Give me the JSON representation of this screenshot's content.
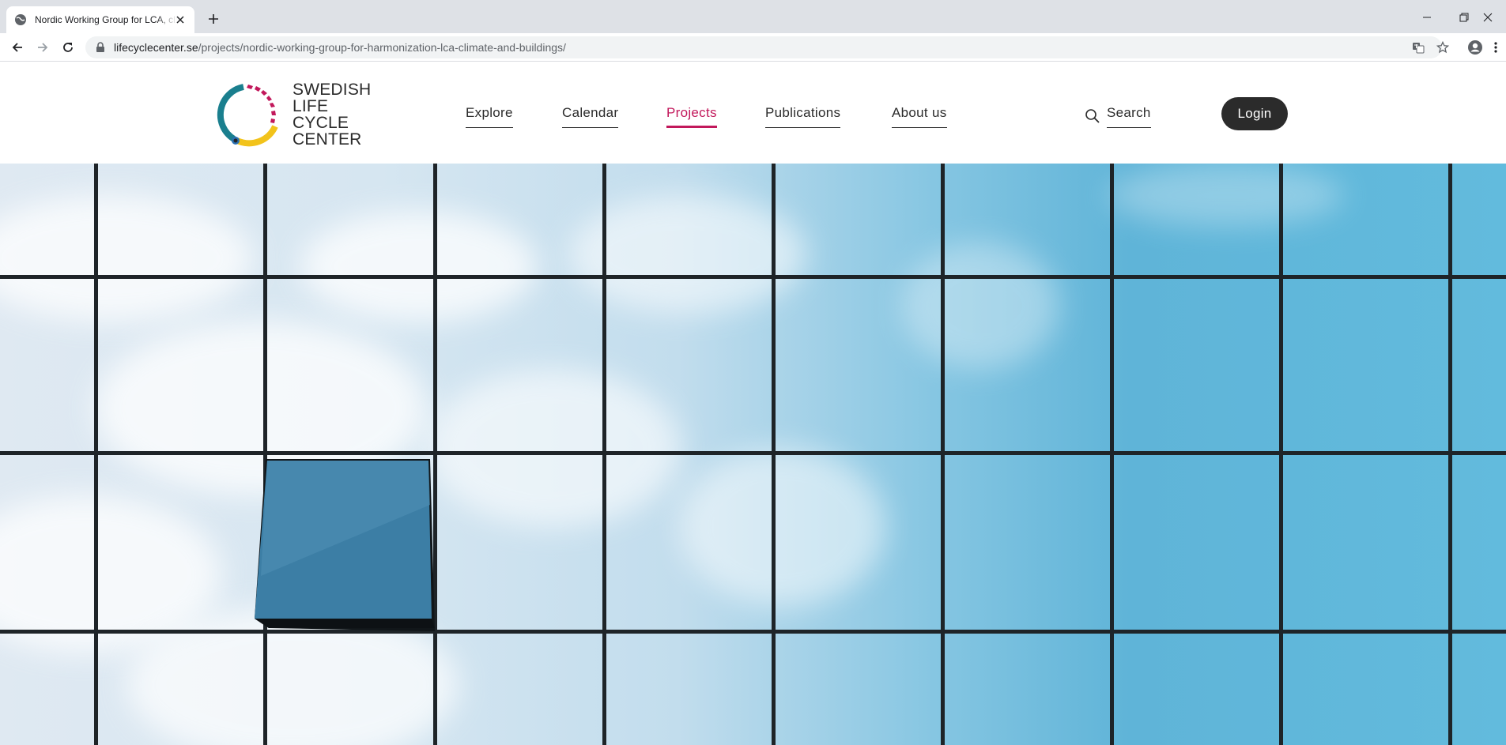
{
  "browser": {
    "tab_title": "Nordic Working Group for LCA, climate and buildings",
    "url_host": "lifecyclecenter.se",
    "url_path": "/projects/nordic-working-group-for-harmonization-lca-climate-and-buildings/"
  },
  "site": {
    "logo_lines": [
      "SWEDISH",
      "LIFE CYCLE",
      "CENTER"
    ],
    "logo_colors": {
      "teal": "#1a7f8e",
      "magenta": "#c2185b",
      "yellow": "#f2c31b",
      "blue": "#2a6fb0"
    },
    "nav": [
      {
        "label": "Explore",
        "active": false
      },
      {
        "label": "Calendar",
        "active": false
      },
      {
        "label": "Projects",
        "active": true
      },
      {
        "label": "Publications",
        "active": false
      },
      {
        "label": "About us",
        "active": false
      }
    ],
    "search_label": "Search",
    "login_label": "Login",
    "accent_color": "#c2185b"
  },
  "hero": {
    "image": "glass facade reflecting blue sky and clouds with one open window"
  }
}
